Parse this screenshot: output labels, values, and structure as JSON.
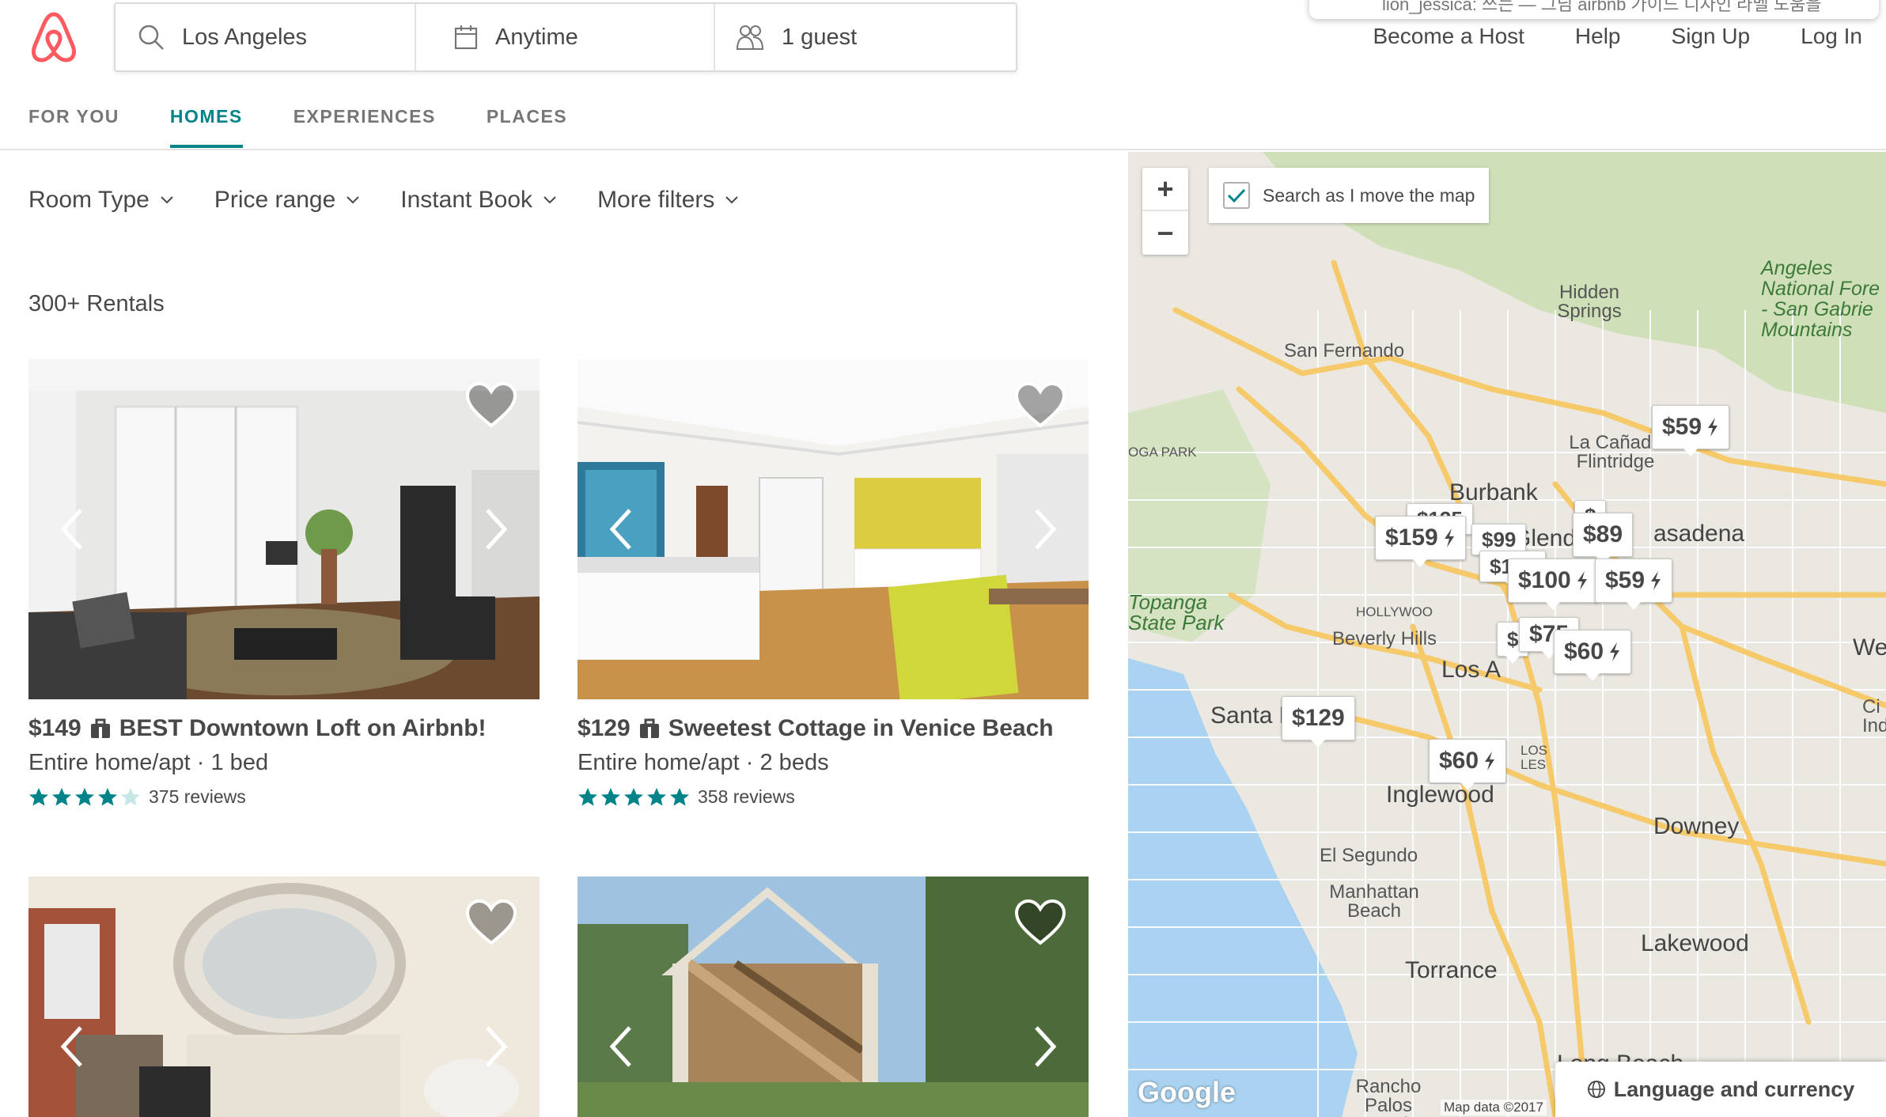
{
  "header": {
    "search": {
      "location": "Los Angeles",
      "dates": "Anytime",
      "guests": "1 guest"
    },
    "nav": [
      "Become a Host",
      "Help",
      "Sign Up",
      "Log In"
    ],
    "tooltip_text": "lion_jessica: 쓰는 — 그님 airbnb 가이드 디자인 라벨 도움을"
  },
  "tabs": [
    {
      "label": "FOR YOU",
      "active": false
    },
    {
      "label": "HOMES",
      "active": true
    },
    {
      "label": "EXPERIENCES",
      "active": false
    },
    {
      "label": "PLACES",
      "active": false
    }
  ],
  "filters": [
    "Room Type",
    "Price range",
    "Instant Book",
    "More filters"
  ],
  "results_count": "300+ Rentals",
  "listings": [
    {
      "price": "$149",
      "title": "BEST Downtown Loft on Airbnb!",
      "details": "Entire home/apt · 1 bed",
      "rating": 4.5,
      "reviews": "375 reviews"
    },
    {
      "price": "$129",
      "title": "Sweetest Cottage in Venice Beach",
      "details": "Entire home/apt · 2 beds",
      "rating": 5,
      "reviews": "358 reviews"
    }
  ],
  "map": {
    "search_as_move": "Search as I move the map",
    "zoom_in": "+",
    "zoom_out": "−",
    "pins": [
      {
        "price": "$59",
        "instant": true
      },
      {
        "price": "$159",
        "instant": true
      },
      {
        "price": "$89",
        "instant": false
      },
      {
        "price": "$100",
        "instant": true
      },
      {
        "price": "$59",
        "instant": true
      },
      {
        "price": "$60",
        "instant": true
      },
      {
        "price": "$129",
        "instant": false
      },
      {
        "price": "$60",
        "instant": true
      }
    ],
    "partial_pins": [
      "$135",
      "$99",
      "$125",
      "$75",
      "$",
      "$"
    ],
    "labels": {
      "san_fernando": "San Fernando",
      "burbank": "Burbank",
      "glendale": "Glenda",
      "pasadena": "asadena",
      "la_canada": "La Cañada\nFlintridge",
      "hidden_springs": "Hidden\nSprings",
      "angeles": "Angeles\nNational Fore\n- San Gabrie\nMountains",
      "topanga": "Topanga\nState Park",
      "beverly_hills": "Beverly Hills",
      "hollywood": "HOLLYWOO",
      "los_angeles": "Los A",
      "santa_monica": "Santa M",
      "inglewood": "Inglewood",
      "el_segundo": "El Segundo",
      "manhattan_beach": "Manhattan\nBeach",
      "torrance": "Torrance",
      "downey": "Downey",
      "lakewood": "Lakewood",
      "long_beach": "Long Beach",
      "rancho": "Rancho\nPalos Verd",
      "park": "OGA PARK",
      "west": "We",
      "city_ind": "Ci\nInd",
      "los_angeles_dist": "LOS\nLES"
    },
    "google_logo": "Google",
    "attribution": "Map data ©2017"
  },
  "footer": {
    "language_currency": "Language and currency"
  },
  "colors": {
    "accent": "#008489",
    "brand": "#FF5A5F",
    "star": "#008489"
  }
}
